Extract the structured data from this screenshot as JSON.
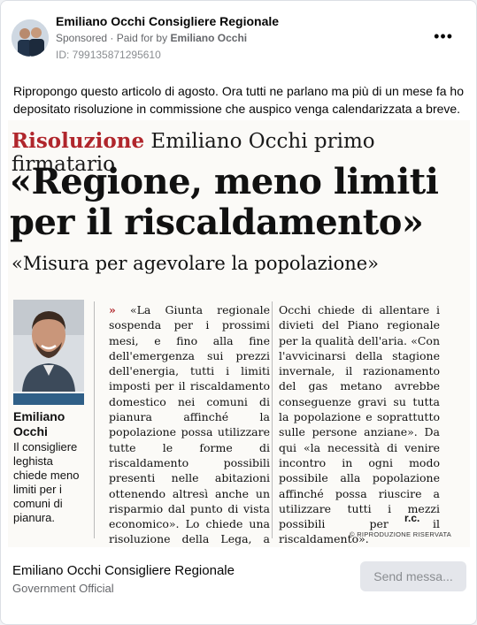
{
  "post": {
    "page_name": "Emiliano Occhi Consigliere Regionale",
    "sponsored_label": "Sponsored",
    "paid_by_label": "Paid for by",
    "paid_by_name": "Emiliano Occhi",
    "id_text": "ID: 799135871295610",
    "more_icon": "more-options-icon",
    "caption": "Ripropongo questo articolo di agosto. Ora tutti ne parlano ma più di un mese fa ho depositato risoluzione in commissione che auspico venga calendarizzata a breve."
  },
  "article": {
    "kicker_red": "Risoluzione",
    "kicker_rest": "Emiliano Occhi primo firmatario",
    "headline": "«Regione, meno limiti per il riscaldamento»",
    "subhead": "«Misura per agevolare la popolazione»",
    "sidebar_name": "Emiliano Occhi",
    "sidebar_desc": "Il consigliere leghista chiede meno limiti per i comuni di pianura.",
    "col1_marker": "»",
    "col1_text": "«La Giunta regionale sospenda per i prossimi mesi, e fino alla fine dell'emergenza sui prezzi dell'energia, tutti i limiti imposti per il riscaldamento domestico nei comuni di pianura affinché la popolazione possa utilizzare tutte le forme di riscaldamento possibili presenti nelle abitazioni ottenendo altresì anche un risparmio dal punto di vista economico». Lo chiede una risoluzione della Lega, a prima firma del consigliere regionale Emiliano Occhi. In pratica,",
    "col2_text": "Occhi chiede di allentare i divieti del Piano regionale per la qualità dell'aria. «Con l'avvicinarsi della stagione invernale, il razionamento del gas metano avrebbe conseguenze gravi su tutta la popolazione e soprattutto sulle persone anziane». Da qui «la necessità di venire incontro in ogni modo possibile alla popolazione affinché possa riuscire a utilizzare tutti i mezzi possibili per il riscaldamento».",
    "signature": "r.c.",
    "reproduction": "© RIPRODUZIONE RISERVATA"
  },
  "footer": {
    "page_name": "Emiliano Occhi Consigliere Regionale",
    "category": "Government Official",
    "send_button": "Send messa..."
  }
}
